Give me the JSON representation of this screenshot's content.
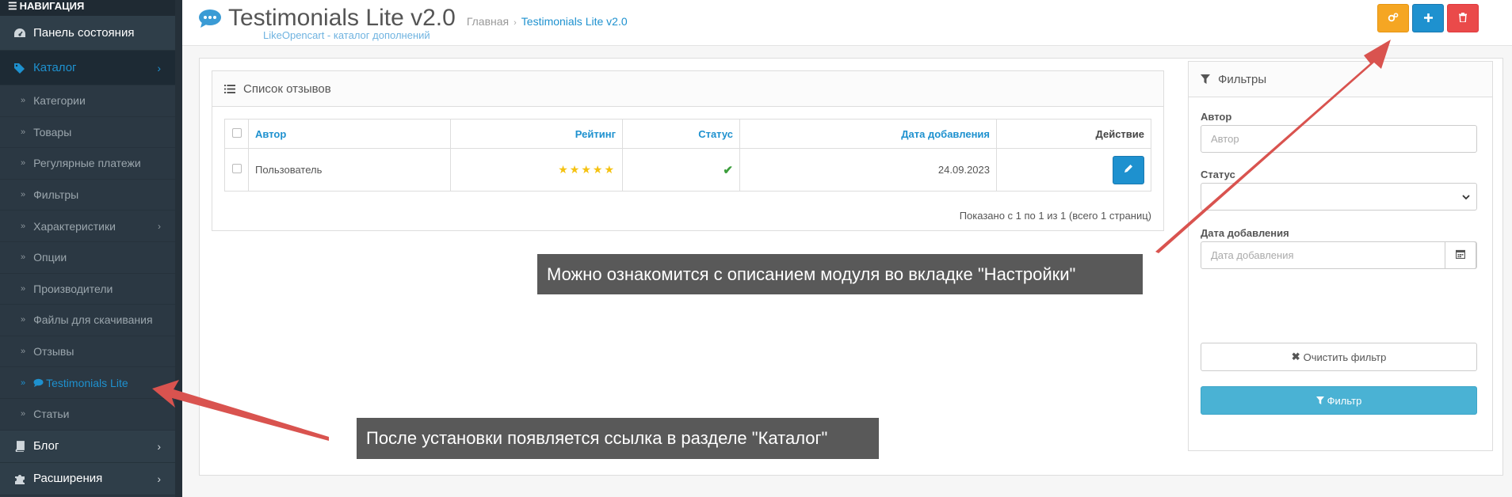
{
  "sidebar": {
    "heading": "НАВИГАЦИЯ",
    "items": [
      {
        "label": "Панель состояния",
        "icon": "dashboard-icon"
      },
      {
        "label": "Каталог",
        "icon": "tags-icon",
        "active": true
      }
    ],
    "catalog_sub": [
      {
        "label": "Категории"
      },
      {
        "label": "Товары"
      },
      {
        "label": "Регулярные платежи"
      },
      {
        "label": "Фильтры"
      },
      {
        "label": "Характеристики",
        "has_children": true
      },
      {
        "label": "Опции"
      },
      {
        "label": "Производители"
      },
      {
        "label": "Файлы для скачивания"
      },
      {
        "label": "Отзывы"
      },
      {
        "label": "Testimonials Lite",
        "active": true
      },
      {
        "label": "Статьи"
      }
    ],
    "bottom": [
      {
        "label": "Блог",
        "icon": "book-icon"
      },
      {
        "label": "Расширения",
        "icon": "puzzle-icon"
      }
    ]
  },
  "header": {
    "title": "Testimonials Lite v2.0",
    "subtitle": "LikeOpencart - каталог дополнений",
    "breadcrumb": [
      "Главная",
      "Testimonials Lite v2.0"
    ],
    "buttons": [
      "settings",
      "add",
      "delete"
    ]
  },
  "list": {
    "heading": "Список отзывов",
    "columns": [
      "Автор",
      "Рейтинг",
      "Статус",
      "Дата добавления",
      "Действие"
    ],
    "rows": [
      {
        "author": "Пользователь",
        "rating": 5,
        "status": "enabled",
        "date": "24.09.2023"
      }
    ],
    "pager": "Показано с 1 по 1 из 1 (всего 1 страниц)"
  },
  "filter": {
    "heading": "Фильтры",
    "author_label": "Автор",
    "author_placeholder": "Автор",
    "status_label": "Статус",
    "status_value": "",
    "date_label": "Дата добавления",
    "date_placeholder": "Дата добавления",
    "clear_label": "Очистить фильтр",
    "apply_label": "Фильтр"
  },
  "annotations": {
    "settings_note": "Можно ознакомится с описанием модуля  во вкладке \"Настройки\"",
    "catalog_note": "После установки появляется ссылка в разделе \"Каталог\""
  },
  "colors": {
    "sidebar_bg": "#2b3843",
    "accent": "#1e91cf",
    "settings_btn": "#f5a623",
    "delete_btn": "#ea4a4a",
    "arrow": "#d9534f",
    "filter_btn": "#4ab2d4"
  }
}
